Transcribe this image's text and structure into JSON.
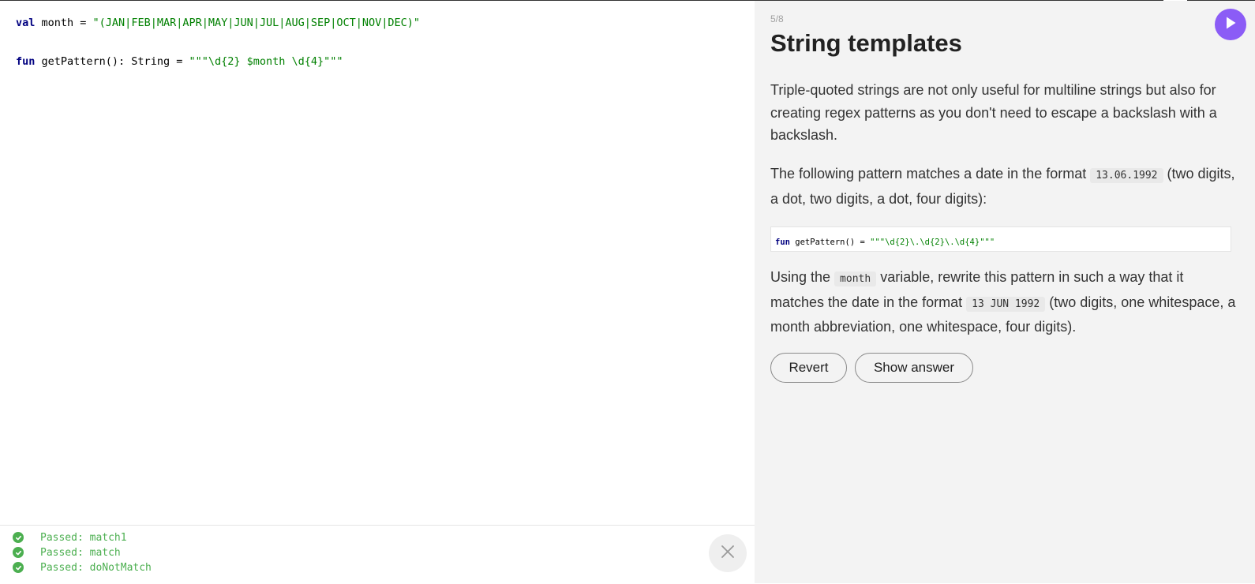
{
  "editor": {
    "lines": [
      {
        "kw": "val",
        "plain": " month = ",
        "str": "\"(JAN|FEB|MAR|APR|MAY|JUN|JUL|AUG|SEP|OCT|NOV|DEC)\""
      },
      {
        "kw": "fun",
        "plain": " getPattern(): String = ",
        "str": "\"\"\"\\d{2} $month \\d{4}\"\"\""
      }
    ]
  },
  "results": [
    {
      "status": "passed",
      "text": "Passed: match1"
    },
    {
      "status": "passed",
      "text": "Passed: match"
    },
    {
      "status": "passed",
      "text": "Passed: doNotMatch"
    }
  ],
  "panel": {
    "counter": "5/8",
    "title": "String templates",
    "para1": "Triple-quoted strings are not only useful for multiline strings but also for creating regex patterns as you don't need to escape a backslash with a backslash.",
    "para2_before": "The following pattern matches a date in the format ",
    "para2_code": "13.06.1992",
    "para2_after": " (two digits, a dot, two digits, a dot, four digits):",
    "code_block": {
      "kw": "fun",
      "plain": " getPattern() = ",
      "str": "\"\"\"\\d{2}\\.\\d{2}\\.\\d{4}\"\"\""
    },
    "para3_before": "Using the ",
    "para3_code1": "month",
    "para3_mid": " variable, rewrite this pattern in such a way that it matches the date in the format ",
    "para3_code2": "13 JUN 1992",
    "para3_after": " (two digits, one whitespace, a month abbreviation, one whitespace, four digits).",
    "buttons": {
      "revert": "Revert",
      "show_answer": "Show answer"
    }
  },
  "colors": {
    "keyword": "#000080",
    "string": "#008000",
    "passed": "#4caf50",
    "run_button": "#8b5cf6",
    "panel_bg": "#f3f3f3"
  },
  "icons": {
    "run": "play-icon",
    "close": "close-icon",
    "passed": "check-circle-icon"
  }
}
